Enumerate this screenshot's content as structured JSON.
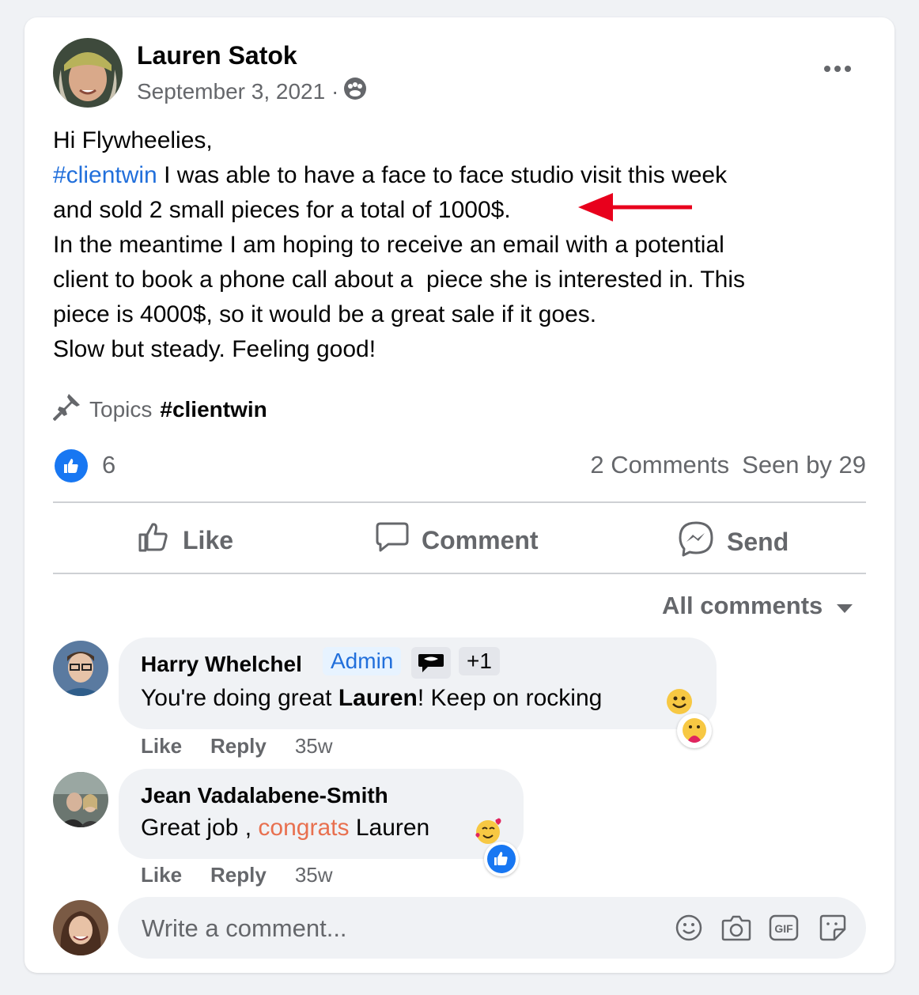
{
  "post": {
    "author": "Lauren Satok",
    "date": "September 3, 2021 ·",
    "privacy_icon": "group-audience-icon",
    "greeting": "Hi Flywheelies,",
    "hashtag": "#clientwin",
    "line1_rest": " I was able to have a face to face studio visit this week",
    "line2": "and sold 2 small pieces for a total of 1000$.",
    "line3": "In the meantime I am hoping to receive an email with a potential",
    "line4": "client to book a phone call about a  piece she is interested in. This",
    "line5": "piece is 4000$, so it would be a great sale if it goes.",
    "line6": "Slow but steady. Feeling good!",
    "annotation_color": "#e8001c"
  },
  "topics": {
    "label": "Topics",
    "tag": "#clientwin"
  },
  "stats": {
    "likes": "6",
    "comments": "2 Comments",
    "seen": "Seen by 29"
  },
  "actions": {
    "like": "Like",
    "comment": "Comment",
    "send": "Send"
  },
  "sort": {
    "label": "All comments"
  },
  "comments": [
    {
      "author": "Harry Whelchel",
      "badge": "Admin",
      "badge_extra": "+1",
      "text_before": "You're doing great ",
      "text_bold": "Lauren",
      "text_after": "! Keep on rocking ",
      "like": "Like",
      "reply": "Reply",
      "time": "35w"
    },
    {
      "author": "Jean Vadalabene-Smith",
      "text_before": "Great job , ",
      "text_highlight": "congrats",
      "text_after": " Lauren",
      "like": "Like",
      "reply": "Reply",
      "time": "35w"
    }
  ],
  "composer": {
    "placeholder": "Write a comment..."
  },
  "colors": {
    "brand_blue": "#1877f2",
    "link": "#216fdb",
    "muted": "#65676b"
  }
}
